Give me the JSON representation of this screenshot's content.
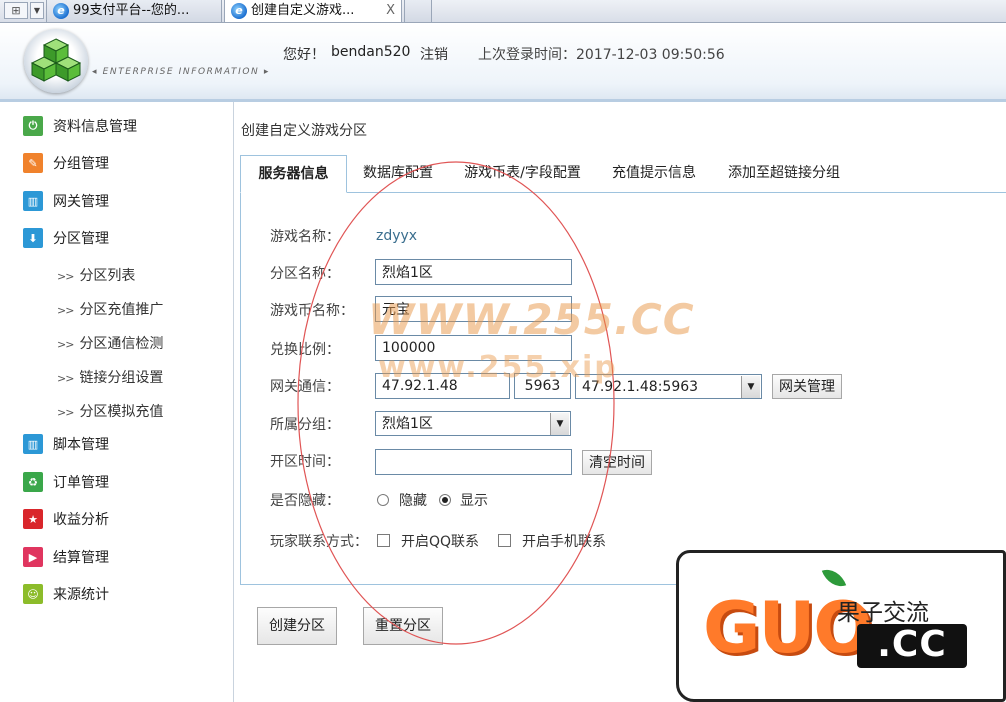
{
  "browser": {
    "tabs": [
      {
        "label": "99支付平台--您的..."
      },
      {
        "label": "创建自定义游戏..."
      }
    ],
    "close_glyph": "X"
  },
  "header": {
    "enterprise_text": "◂ ENTERPRISE INFORMATION ▸",
    "greeting": "您好！",
    "username": "bendan520",
    "logout": "注销",
    "last_login": "上次登录时间：2017-12-03 09:50:56"
  },
  "sidebar": {
    "items": [
      {
        "label": "资料信息管理",
        "icon": "power-icon",
        "color": "#4aa84a",
        "glyph": "⏻"
      },
      {
        "label": "分组管理",
        "icon": "pencil-icon",
        "color": "#f0822c",
        "glyph": "✎"
      },
      {
        "label": "网关管理",
        "icon": "gateway-icon",
        "color": "#2c98d6",
        "glyph": "▥"
      },
      {
        "label": "分区管理",
        "icon": "download-icon",
        "color": "#2c98d6",
        "glyph": "⬇"
      },
      {
        "label": "脚本管理",
        "icon": "script-icon",
        "color": "#2c98d6",
        "glyph": "▥"
      },
      {
        "label": "订单管理",
        "icon": "recycle-icon",
        "color": "#3aa74a",
        "glyph": "♻"
      },
      {
        "label": "收益分析",
        "icon": "star-icon",
        "color": "#d9262b",
        "glyph": "★"
      },
      {
        "label": "结算管理",
        "icon": "play-icon",
        "color": "#e0355f",
        "glyph": "▶"
      },
      {
        "label": "来源统计",
        "icon": "smile-icon",
        "color": "#8cbc2a",
        "glyph": "☺"
      }
    ],
    "sub_items": [
      {
        "label": "分区列表"
      },
      {
        "label": "分区充值推广"
      },
      {
        "label": "分区通信检测"
      },
      {
        "label": "链接分组设置"
      },
      {
        "label": "分区模拟充值"
      }
    ],
    "sub_arrow": ">>"
  },
  "page": {
    "title": "创建自定义游戏分区",
    "tabs": [
      {
        "label": "服务器信息"
      },
      {
        "label": "数据库配置"
      },
      {
        "label": "游戏币表/字段配置"
      },
      {
        "label": "充值提示信息"
      },
      {
        "label": "添加至超链接分组"
      }
    ]
  },
  "form": {
    "game_name_label": "游戏名称：",
    "game_name_value": "zdyyx",
    "zone_name_label": "分区名称：",
    "zone_name_value": "烈焰1区",
    "currency_label": "游戏币名称：",
    "currency_value": "元宝",
    "ratio_label": "兑换比例：",
    "ratio_value": "100000",
    "gateway_label": "网关通信：",
    "gateway_ip": "47.92.1.48",
    "gateway_port": "5963",
    "gateway_select": "47.92.1.48:5963",
    "gateway_button": "网关管理",
    "group_label": "所属分组：",
    "group_select": "烈焰1区",
    "open_time_label": "开区时间：",
    "open_time_value": "",
    "clear_time_button": "清空时间",
    "hidden_label": "是否隐藏：",
    "hidden_option": "隐藏",
    "show_option": "显示",
    "contact_label": "玩家联系方式：",
    "qq_option": "开启QQ联系",
    "phone_option": "开启手机联系"
  },
  "actions": {
    "create": "创建分区",
    "reset": "重置分区"
  },
  "watermarks": {
    "line1": "WWW.255.CC",
    "line2": "www.255.xip"
  },
  "logo": {
    "brand": "GUO",
    "cn": "果子交流",
    "domain": ".CC"
  },
  "colors": {
    "accent_border": "#9ec3de",
    "ellipse": "#e05555",
    "logo_orange": "#ff7a2a"
  }
}
